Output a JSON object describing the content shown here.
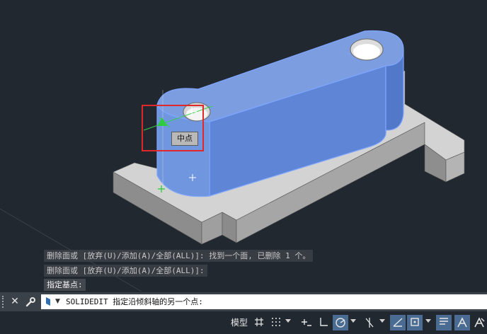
{
  "viewport": {
    "tooltip": "中点",
    "history": [
      "删除面或 [放弃(U)/添加(A)/全部(ALL)]: 找到一个面, 已删除 1 个。",
      "删除面或 [放弃(U)/添加(A)/全部(ALL)]:",
      "指定基点:"
    ]
  },
  "command_line": {
    "text": "SOLIDEDIT 指定沿倾斜轴的另一个点:",
    "close_icon": "close-icon",
    "customize_icon": "wrench-icon"
  },
  "status_bar": {
    "model_label": "模型",
    "toggles": [
      {
        "name": "grid-icon",
        "on": false
      },
      {
        "name": "snap-icon",
        "on": false
      },
      {
        "name": "infer-constraints-icon",
        "on": false
      },
      {
        "name": "ortho-icon",
        "on": false
      },
      {
        "name": "polar-icon",
        "on": true
      },
      {
        "name": "isodraft-icon",
        "on": false
      },
      {
        "name": "object-snap-tracking-icon",
        "on": true
      },
      {
        "name": "object-snap-icon",
        "on": true
      },
      {
        "name": "lineweight-icon",
        "on": true
      },
      {
        "name": "annotation-scale-icon",
        "on": true
      },
      {
        "name": "annotation-visibility-icon",
        "on": false
      }
    ]
  },
  "colors": {
    "background": "#212830",
    "selected_face": "#6a8fd8",
    "selection_edge": "#5a8cff",
    "gray_solid": "#cfcfcf",
    "highlight_box": "#e02828",
    "snap_marker": "#2ecc40"
  }
}
